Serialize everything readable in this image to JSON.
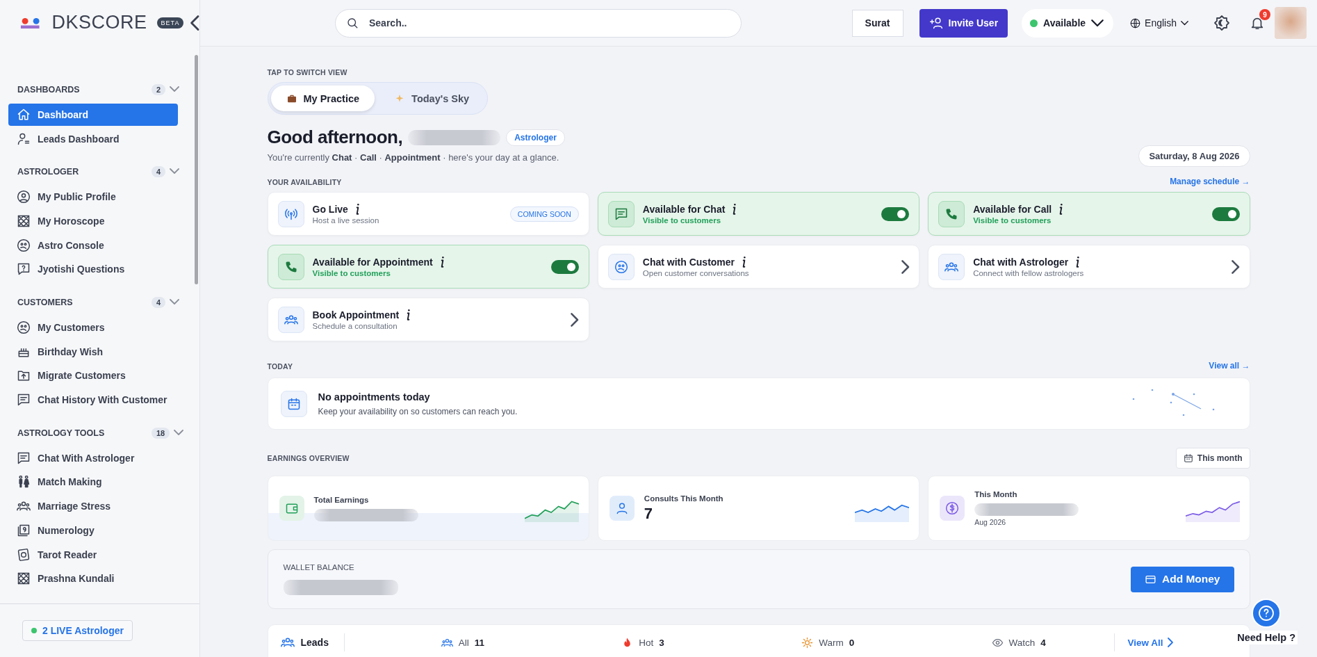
{
  "sidebar": {
    "brand": "DKSCORE",
    "badge": "BETA",
    "sections": [
      {
        "title": "DASHBOARDS",
        "count": "2",
        "items": [
          {
            "label": "Dashboard",
            "selected": true
          },
          {
            "label": "Leads Dashboard",
            "selected": false
          }
        ]
      },
      {
        "title": "ASTROLOGER",
        "count": "4",
        "items": [
          {
            "label": "My Public Profile",
            "selected": false
          },
          {
            "label": "My Horoscope",
            "selected": false
          },
          {
            "label": "Astro Console",
            "selected": false
          },
          {
            "label": "Jyotishi Questions",
            "selected": false
          }
        ]
      },
      {
        "title": "CUSTOMERS",
        "count": "4",
        "items": [
          {
            "label": "My Customers",
            "selected": false
          },
          {
            "label": "Birthday Wish",
            "selected": false
          },
          {
            "label": "Migrate Customers",
            "selected": false
          },
          {
            "label": "Chat History With Customer",
            "selected": false
          }
        ]
      },
      {
        "title": "ASTROLOGY TOOLS",
        "count": "18",
        "items": [
          {
            "label": "Chat With Astrologer",
            "selected": false
          },
          {
            "label": "Match Making",
            "selected": false
          },
          {
            "label": "Marriage Stress",
            "selected": false
          },
          {
            "label": "Numerology",
            "selected": false
          },
          {
            "label": "Tarot Reader",
            "selected": false
          },
          {
            "label": "Prashna Kundali",
            "selected": false
          }
        ]
      }
    ],
    "live_button": "2 LIVE Astrologer"
  },
  "header": {
    "search": {
      "placeholder": "Search.."
    },
    "city": "Surat",
    "invite": "Invite User",
    "status": "Available",
    "language": "English",
    "notifications": "9"
  },
  "main": {
    "switch_label": "TAP TO SWITCH VIEW",
    "view_tabs": [
      {
        "label": "My Practice",
        "selected": true
      },
      {
        "label": "Today's Sky",
        "selected": false
      }
    ],
    "greeting": "Good afternoon,",
    "role": "Astrologer",
    "subtitle": "You're currently **Chat** · **Call** · **Appointment** · here's your day at a glance.",
    "date": "Saturday, 8 Aug 2026",
    "availability": {
      "heading": "YOUR AVAILABILITY",
      "link": "Manage schedule →",
      "cards": [
        {
          "kind": "badge",
          "title": "Go Live",
          "subtitle": "Host a live session",
          "badge": "COMING SOON"
        },
        {
          "kind": "toggle",
          "title": "Available for Chat",
          "subtitle": "Visible to customers",
          "on": true
        },
        {
          "kind": "toggle",
          "title": "Available for Call",
          "subtitle": "Visible to customers",
          "on": true
        },
        {
          "kind": "toggle",
          "title": "Available for Appointment",
          "subtitle": "Visible to customers",
          "on": true
        },
        {
          "kind": "link",
          "title": "Chat with Customer",
          "subtitle": "Open customer conversations"
        },
        {
          "kind": "link",
          "title": "Chat with Astrologer",
          "subtitle": "Connect with fellow astrologers"
        },
        {
          "kind": "link",
          "title": "Book Appointment",
          "subtitle": "Schedule a consultation"
        }
      ]
    },
    "today": {
      "heading": "TODAY",
      "link": "View all →",
      "title": "No appointments today",
      "text": "Keep your availability on so customers can reach you."
    },
    "earnings": {
      "heading": "EARNINGS OVERVIEW",
      "period": "This month",
      "stats": [
        {
          "label": "Total Earnings",
          "color": "#22a05a"
        },
        {
          "label": "Consults This Month",
          "value": "7",
          "color": "#2574e8"
        },
        {
          "label": "This Month",
          "note": "Aug 2026",
          "color": "#7c5ce6"
        }
      ]
    },
    "wallet": {
      "label": "WALLET BALANCE",
      "button": "Add Money"
    },
    "leads": {
      "title": "Leads",
      "filters": [
        {
          "label": "All",
          "count": "11"
        },
        {
          "label": "Hot",
          "count": "3"
        },
        {
          "label": "Warm",
          "count": "0"
        },
        {
          "label": "Watch",
          "count": "4"
        }
      ],
      "link": "View All"
    }
  },
  "help": "Need Help ?"
}
